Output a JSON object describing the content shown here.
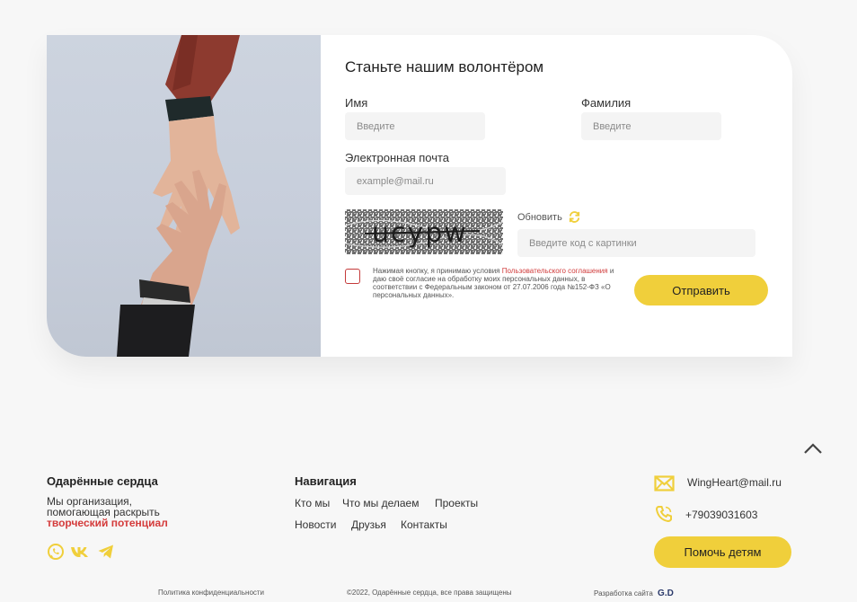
{
  "form": {
    "title": "Станьте нашим волонтёром",
    "first_name_label": "Имя",
    "first_name_placeholder": "Введите",
    "last_name_label": "Фамилия",
    "last_name_placeholder": "Введите",
    "email_label": "Электронная почта",
    "email_placeholder": "example@mail.ru",
    "captcha_text": "ucypw",
    "refresh_label": "Обновить",
    "captcha_placeholder": "Введите код с картинки",
    "consent_before": "Нажимая кнопку, я принимаю условия ",
    "consent_link": "Пользовательского соглашения",
    "consent_after": " и даю своё согласие на обработку моих персональных данных, в соответствии с Федеральным законом от 27.07.2006 года №152-ФЗ «О персональных данных».",
    "submit_label": "Отправить"
  },
  "footer": {
    "org_title": "Одарённые сердца",
    "org_text_line1": "Мы организация,",
    "org_text_line2": "помогающая раскрыть",
    "org_text_accent": "творческий потенциал",
    "nav_title": "Навигация",
    "nav_links": [
      "Кто мы",
      "Что мы делаем",
      "Проекты",
      "Новости",
      "Друзья",
      "Контакты"
    ],
    "email": "WingHeart@mail.ru",
    "phone": "+79039031603",
    "help_button": "Помочь детям",
    "privacy": "Политика конфиденциальности",
    "copyright": "©2022, Одарённые сердца, все права защищены",
    "developer": "Разработка сайта",
    "developer_logo": "G.D"
  },
  "icons": {
    "social": [
      "whatsapp-icon",
      "vk-icon",
      "telegram-icon"
    ],
    "contacts": [
      "mail-icon",
      "phone-icon"
    ],
    "refresh": "refresh-icon",
    "scroll_top": "chevron-up-icon"
  },
  "colors": {
    "accent_yellow": "#f0cf3b",
    "accent_red": "#d43b3b",
    "background": "#f7f7f7"
  }
}
